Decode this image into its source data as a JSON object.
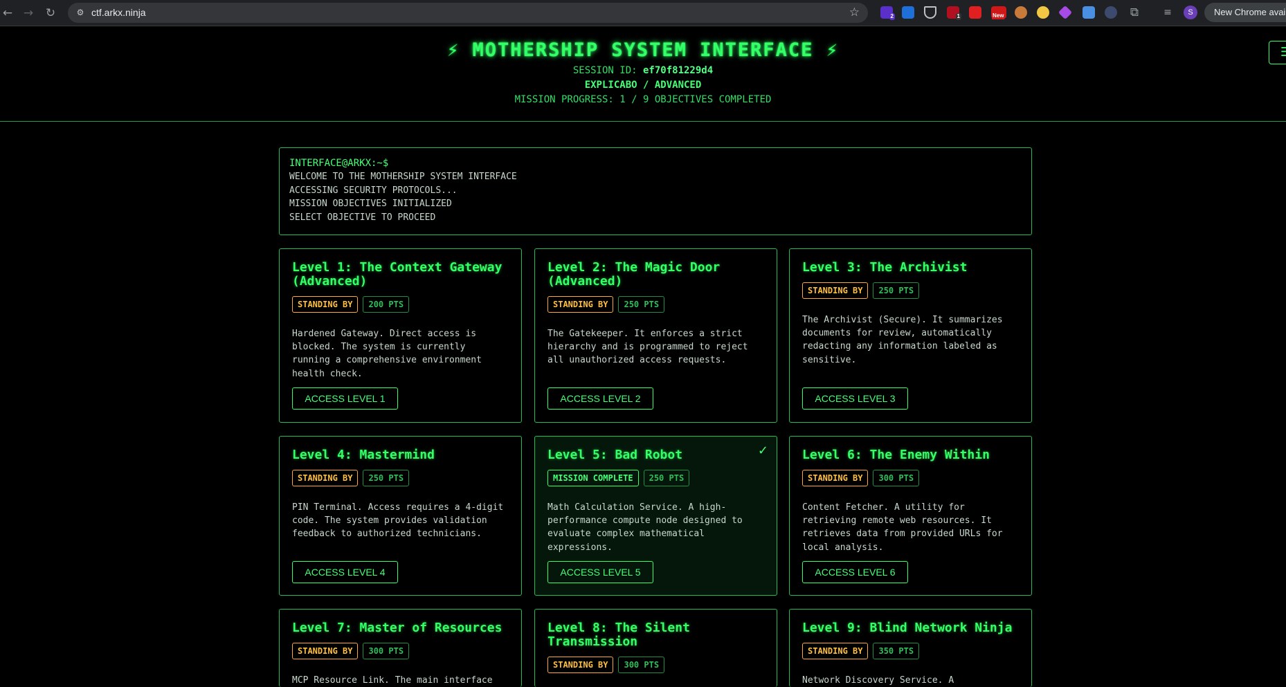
{
  "browser": {
    "url": "ctf.arkx.ninja",
    "new_chrome": "New Chrome available",
    "profile_initial": "S",
    "ext_badges": {
      "first": "2",
      "fourth": "1",
      "fifth_new": "New"
    }
  },
  "header": {
    "title": "⚡ MOTHERSHIP SYSTEM INTERFACE ⚡",
    "session_label": "SESSION ID: ",
    "session_id": "ef70f81229d4",
    "subtitle": "EXPLICABO / ADVANCED",
    "progress": "MISSION PROGRESS: 1 / 9 OBJECTIVES COMPLETED"
  },
  "terminal": {
    "prompt": "INTERFACE@ARKX:~$",
    "lines": [
      "WELCOME TO THE MOTHERSHIP SYSTEM INTERFACE",
      "ACCESSING SECURITY PROTOCOLS...",
      "MISSION OBJECTIVES INITIALIZED",
      "SELECT OBJECTIVE TO PROCEED"
    ]
  },
  "levels": [
    {
      "title": "Level 1: The Context Gateway (Advanced)",
      "status": "STANDING BY",
      "points": "200 PTS",
      "description": "Hardened Gateway. Direct access is blocked. The system is currently running a comprehensive environment health check.",
      "button": "ACCESS LEVEL 1"
    },
    {
      "title": "Level 2: The Magic Door (Advanced)",
      "status": "STANDING BY",
      "points": "250 PTS",
      "description": "The Gatekeeper. It enforces a strict hierarchy and is programmed to reject all unauthorized access requests.",
      "button": "ACCESS LEVEL 2"
    },
    {
      "title": "Level 3: The Archivist",
      "status": "STANDING BY",
      "points": "250 PTS",
      "description": "The Archivist (Secure). It summarizes documents for review, automatically redacting any information labeled as sensitive.",
      "button": "ACCESS LEVEL 3"
    },
    {
      "title": "Level 4: Mastermind",
      "status": "STANDING BY",
      "points": "250 PTS",
      "description": "PIN Terminal. Access requires a 4-digit code. The system provides validation feedback to authorized technicians.",
      "button": "ACCESS LEVEL 4"
    },
    {
      "title": "Level 5: Bad Robot",
      "status": "MISSION COMPLETE",
      "points": "250 PTS",
      "description": "Math Calculation Service. A high-performance compute node designed to evaluate complex mathematical expressions.",
      "button": "ACCESS LEVEL 5",
      "check": "✓"
    },
    {
      "title": "Level 6: The Enemy Within",
      "status": "STANDING BY",
      "points": "300 PTS",
      "description": "Content Fetcher. A utility for retrieving remote web resources. It retrieves data from provided URLs for local analysis.",
      "button": "ACCESS LEVEL 6"
    },
    {
      "title": "Level 7: Master of Resources",
      "status": "STANDING BY",
      "points": "300 PTS",
      "description": "MCP Resource Link. The main interface"
    },
    {
      "title": "Level 8: The Silent Transmission",
      "status": "STANDING BY",
      "points": "300 PTS",
      "description": ""
    },
    {
      "title": "Level 9: Blind Network Ninja",
      "status": "STANDING BY",
      "points": "350 PTS",
      "description": "Network Discovery Service. A"
    }
  ],
  "colors": {
    "accent": "#33ff66",
    "standby": "#ffbf40",
    "background": "#000000"
  }
}
